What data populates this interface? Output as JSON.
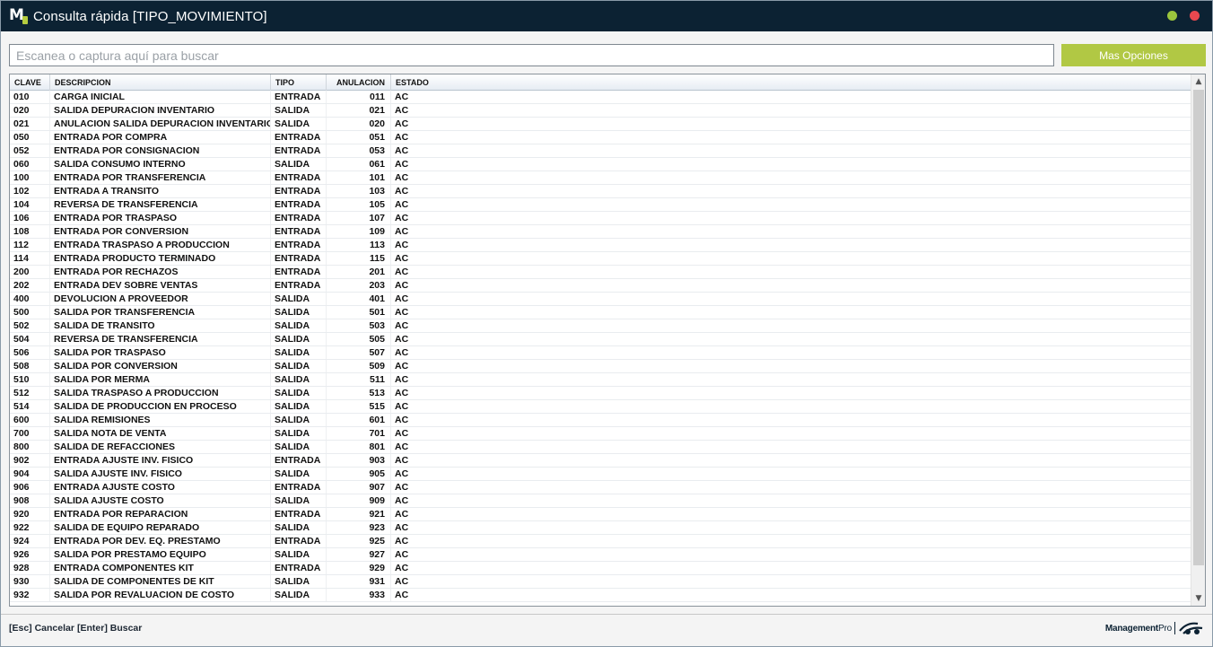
{
  "window": {
    "title": "Consulta rápida [TIPO_MOVIMIENTO]",
    "logo_letter": "M"
  },
  "search": {
    "placeholder": "Escanea o captura aquí para buscar",
    "value": "",
    "more_button_label": "Mas Opciones"
  },
  "table": {
    "columns": {
      "clave": "CLAVE",
      "descripcion": "DESCRIPCION",
      "tipo": "TIPO",
      "anulacion": "ANULACION",
      "estado": "ESTADO"
    },
    "rows": [
      {
        "clave": "010",
        "descripcion": "CARGA INICIAL",
        "tipo": "ENTRADA",
        "anulacion": "011",
        "estado": "AC"
      },
      {
        "clave": "020",
        "descripcion": "SALIDA DEPURACION INVENTARIO",
        "tipo": "SALIDA",
        "anulacion": "021",
        "estado": "AC"
      },
      {
        "clave": "021",
        "descripcion": "ANULACION SALIDA DEPURACION INVENTARIO",
        "tipo": "SALIDA",
        "anulacion": "020",
        "estado": "AC"
      },
      {
        "clave": "050",
        "descripcion": "ENTRADA POR COMPRA",
        "tipo": "ENTRADA",
        "anulacion": "051",
        "estado": "AC"
      },
      {
        "clave": "052",
        "descripcion": "ENTRADA POR CONSIGNACION",
        "tipo": "ENTRADA",
        "anulacion": "053",
        "estado": "AC"
      },
      {
        "clave": "060",
        "descripcion": "SALIDA CONSUMO INTERNO",
        "tipo": "SALIDA",
        "anulacion": "061",
        "estado": "AC"
      },
      {
        "clave": "100",
        "descripcion": "ENTRADA POR TRANSFERENCIA",
        "tipo": "ENTRADA",
        "anulacion": "101",
        "estado": "AC"
      },
      {
        "clave": "102",
        "descripcion": "ENTRADA A TRANSITO",
        "tipo": "ENTRADA",
        "anulacion": "103",
        "estado": "AC"
      },
      {
        "clave": "104",
        "descripcion": "REVERSA DE TRANSFERENCIA",
        "tipo": "ENTRADA",
        "anulacion": "105",
        "estado": "AC"
      },
      {
        "clave": "106",
        "descripcion": "ENTRADA POR TRASPASO",
        "tipo": "ENTRADA",
        "anulacion": "107",
        "estado": "AC"
      },
      {
        "clave": "108",
        "descripcion": "ENTRADA POR CONVERSION",
        "tipo": "ENTRADA",
        "anulacion": "109",
        "estado": "AC"
      },
      {
        "clave": "112",
        "descripcion": "ENTRADA TRASPASO A PRODUCCION",
        "tipo": "ENTRADA",
        "anulacion": "113",
        "estado": "AC"
      },
      {
        "clave": "114",
        "descripcion": "ENTRADA PRODUCTO TERMINADO",
        "tipo": "ENTRADA",
        "anulacion": "115",
        "estado": "AC"
      },
      {
        "clave": "200",
        "descripcion": "ENTRADA POR RECHAZOS",
        "tipo": "ENTRADA",
        "anulacion": "201",
        "estado": "AC"
      },
      {
        "clave": "202",
        "descripcion": "ENTRADA DEV SOBRE VENTAS",
        "tipo": "ENTRADA",
        "anulacion": "203",
        "estado": "AC"
      },
      {
        "clave": "400",
        "descripcion": "DEVOLUCION A PROVEEDOR",
        "tipo": "SALIDA",
        "anulacion": "401",
        "estado": "AC"
      },
      {
        "clave": "500",
        "descripcion": "SALIDA POR TRANSFERENCIA",
        "tipo": "SALIDA",
        "anulacion": "501",
        "estado": "AC"
      },
      {
        "clave": "502",
        "descripcion": "SALIDA DE TRANSITO",
        "tipo": "SALIDA",
        "anulacion": "503",
        "estado": "AC"
      },
      {
        "clave": "504",
        "descripcion": "REVERSA DE TRANSFERENCIA",
        "tipo": "SALIDA",
        "anulacion": "505",
        "estado": "AC"
      },
      {
        "clave": "506",
        "descripcion": "SALIDA POR TRASPASO",
        "tipo": "SALIDA",
        "anulacion": "507",
        "estado": "AC"
      },
      {
        "clave": "508",
        "descripcion": "SALIDA POR CONVERSION",
        "tipo": "SALIDA",
        "anulacion": "509",
        "estado": "AC"
      },
      {
        "clave": "510",
        "descripcion": "SALIDA POR MERMA",
        "tipo": "SALIDA",
        "anulacion": "511",
        "estado": "AC"
      },
      {
        "clave": "512",
        "descripcion": "SALIDA TRASPASO A PRODUCCION",
        "tipo": "SALIDA",
        "anulacion": "513",
        "estado": "AC"
      },
      {
        "clave": "514",
        "descripcion": "SALIDA DE PRODUCCION EN PROCESO",
        "tipo": "SALIDA",
        "anulacion": "515",
        "estado": "AC"
      },
      {
        "clave": "600",
        "descripcion": "SALIDA REMISIONES",
        "tipo": "SALIDA",
        "anulacion": "601",
        "estado": "AC"
      },
      {
        "clave": "700",
        "descripcion": "SALIDA NOTA DE VENTA",
        "tipo": "SALIDA",
        "anulacion": "701",
        "estado": "AC"
      },
      {
        "clave": "800",
        "descripcion": "SALIDA DE REFACCIONES",
        "tipo": "SALIDA",
        "anulacion": "801",
        "estado": "AC"
      },
      {
        "clave": "902",
        "descripcion": "ENTRADA AJUSTE INV. FISICO",
        "tipo": "ENTRADA",
        "anulacion": "903",
        "estado": "AC"
      },
      {
        "clave": "904",
        "descripcion": "SALIDA AJUSTE INV. FISICO",
        "tipo": "SALIDA",
        "anulacion": "905",
        "estado": "AC"
      },
      {
        "clave": "906",
        "descripcion": "ENTRADA AJUSTE COSTO",
        "tipo": "ENTRADA",
        "anulacion": "907",
        "estado": "AC"
      },
      {
        "clave": "908",
        "descripcion": "SALIDA AJUSTE COSTO",
        "tipo": "SALIDA",
        "anulacion": "909",
        "estado": "AC"
      },
      {
        "clave": "920",
        "descripcion": "ENTRADA POR REPARACION",
        "tipo": "ENTRADA",
        "anulacion": "921",
        "estado": "AC"
      },
      {
        "clave": "922",
        "descripcion": "SALIDA DE EQUIPO REPARADO",
        "tipo": "SALIDA",
        "anulacion": "923",
        "estado": "AC"
      },
      {
        "clave": "924",
        "descripcion": "ENTRADA POR DEV. EQ. PRESTAMO",
        "tipo": "ENTRADA",
        "anulacion": "925",
        "estado": "AC"
      },
      {
        "clave": "926",
        "descripcion": "SALIDA POR PRESTAMO EQUIPO",
        "tipo": "SALIDA",
        "anulacion": "927",
        "estado": "AC"
      },
      {
        "clave": "928",
        "descripcion": "ENTRADA COMPONENTES KIT",
        "tipo": "ENTRADA",
        "anulacion": "929",
        "estado": "AC"
      },
      {
        "clave": "930",
        "descripcion": "SALIDA DE COMPONENTES DE KIT",
        "tipo": "SALIDA",
        "anulacion": "931",
        "estado": "AC"
      },
      {
        "clave": "932",
        "descripcion": "SALIDA POR REVALUACION DE COSTO",
        "tipo": "SALIDA",
        "anulacion": "933",
        "estado": "AC"
      }
    ]
  },
  "footer": {
    "esc_hint": "[Esc] Cancelar",
    "enter_hint": "[Enter] Buscar",
    "brand_name": "Management",
    "brand_suffix": "Pro"
  },
  "colors": {
    "titlebar": "#0c2233",
    "accent_green": "#b1c844",
    "minimize": "#9bc53d",
    "close": "#e8484f"
  }
}
